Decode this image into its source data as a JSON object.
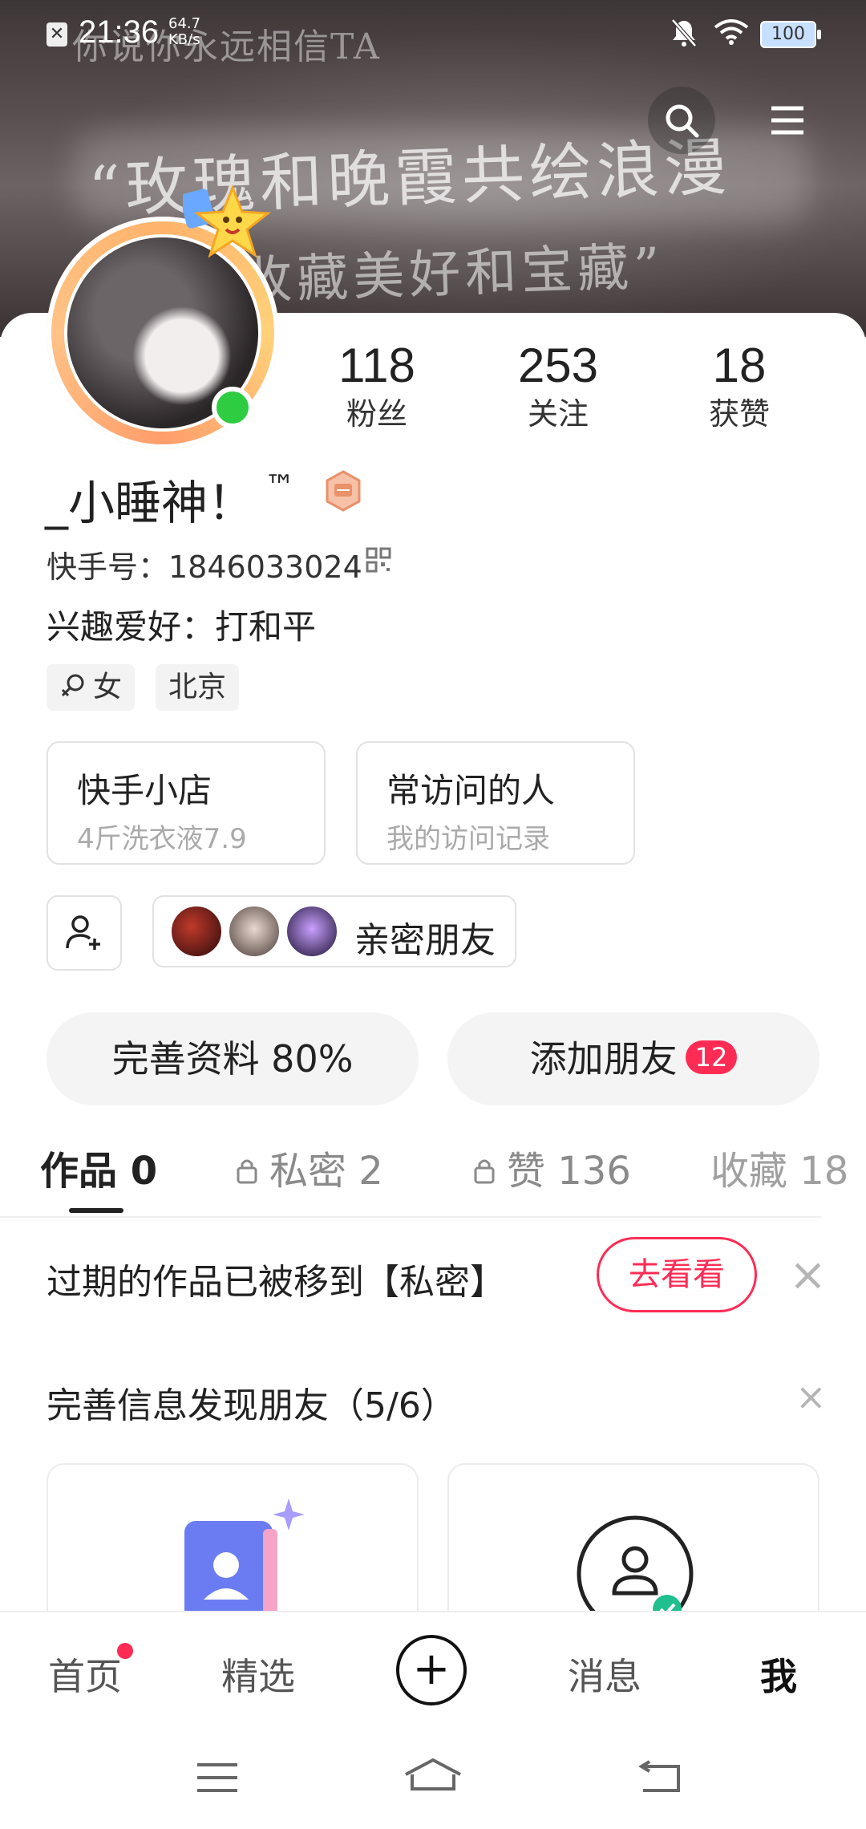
{
  "status_bar": {
    "time": "21:36",
    "speed_value": "64.7",
    "speed_unit": "KB/s",
    "battery": "100"
  },
  "banner": {
    "line1": "你说你永远相信TA",
    "line2": "“玫瑰和晚霞共绘浪漫",
    "line3": "收藏美好和宝藏”"
  },
  "profile": {
    "nickname": "_小睡神！",
    "tm": "™",
    "kwai_id": "快手号：1846033024",
    "hobby": "兴趣爱好：打和平",
    "gender_chip": "女",
    "location_chip": "北京"
  },
  "stats": [
    {
      "value": "118",
      "label": "粉丝"
    },
    {
      "value": "253",
      "label": "关注"
    },
    {
      "value": "18",
      "label": "获赞"
    }
  ],
  "cards": [
    {
      "title": "快手小店",
      "subtitle": "4斤洗衣液7.9"
    },
    {
      "title": "常访问的人",
      "subtitle": "我的访问记录"
    }
  ],
  "close_friends": {
    "label": "亲密朋友"
  },
  "actions": {
    "complete_profile": "完善资料 80%",
    "add_friends": "添加朋友",
    "add_friends_count": "12"
  },
  "tabs": [
    {
      "label": "作品 0"
    },
    {
      "label": "私密 2"
    },
    {
      "label": "赞 136"
    },
    {
      "label": "收藏 18"
    }
  ],
  "notice": {
    "text": "过期的作品已被移到【私密】",
    "button": "去看看"
  },
  "discover": {
    "title": "完善信息发现朋友（5/6）"
  },
  "bottom_nav": [
    {
      "label": "首页"
    },
    {
      "label": "精选"
    },
    {
      "label": "消息"
    },
    {
      "label": "我"
    }
  ],
  "colors": {
    "accent": "#fe2c55",
    "online": "#2ecc40"
  }
}
